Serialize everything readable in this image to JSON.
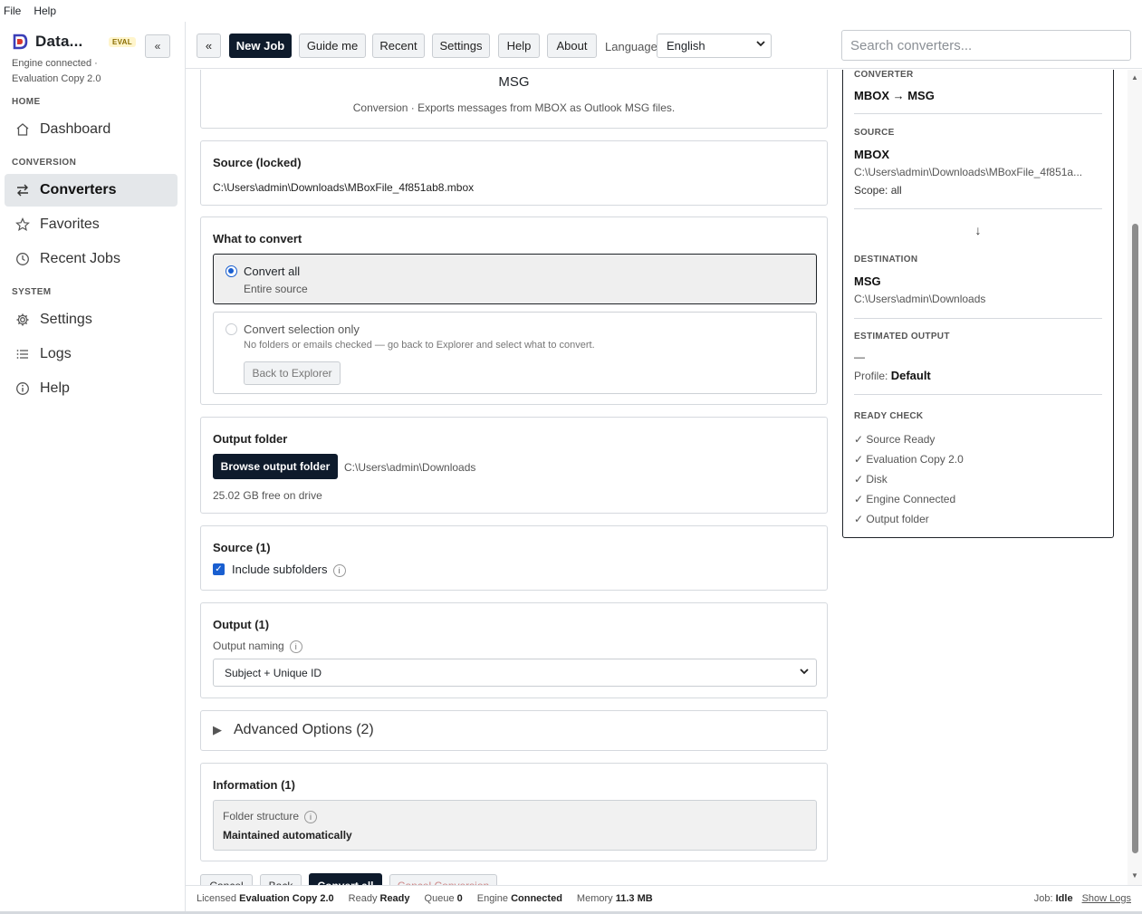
{
  "menu": {
    "file": "File",
    "help": "Help"
  },
  "brand": {
    "name": "Data...",
    "badge": "EVAL",
    "collapse": "«",
    "status_line1": "Engine connected ·",
    "status_line2": "Evaluation Copy 2.0"
  },
  "sidebar": {
    "sections": {
      "home": "HOME",
      "conversion": "CONVERSION",
      "system": "SYSTEM"
    },
    "items": [
      {
        "label": "Dashboard",
        "icon": "home-icon"
      },
      {
        "label": "Converters",
        "icon": "arrows-swap-icon",
        "active": true
      },
      {
        "label": "Favorites",
        "icon": "star-icon"
      },
      {
        "label": "Recent Jobs",
        "icon": "clock-icon"
      },
      {
        "label": "Settings",
        "icon": "gear-icon"
      },
      {
        "label": "Logs",
        "icon": "list-icon"
      },
      {
        "label": "Help",
        "icon": "info-icon"
      }
    ]
  },
  "toolbar": {
    "back": "«",
    "new_job": "New Job",
    "guide": "Guide me",
    "recent": "Recent",
    "settings": "Settings",
    "help": "Help",
    "about": "About",
    "language_label": "Language",
    "language_value": "English",
    "search_placeholder": "Search converters..."
  },
  "header_card": {
    "title": "MSG",
    "subtitle": "Conversion · Exports messages from MBOX as Outlook MSG files."
  },
  "source_locked": {
    "title": "Source (locked)",
    "path": "C:\\Users\\admin\\Downloads\\MBoxFile_4f851ab8.mbox"
  },
  "what_to_convert": {
    "title": "What to convert",
    "all_label": "Convert all",
    "all_sub": "Entire source",
    "sel_label": "Convert selection only",
    "sel_sub": "No folders or emails checked — go back to Explorer and select what to convert.",
    "back_btn": "Back to Explorer"
  },
  "output_folder": {
    "title": "Output folder",
    "browse": "Browse output folder",
    "path": "C:\\Users\\admin\\Downloads",
    "free": "25.02 GB free on drive"
  },
  "source_opts": {
    "title": "Source (1)",
    "include_subfolders": "Include subfolders",
    "info": "i"
  },
  "output_opts": {
    "title": "Output (1)",
    "naming_label": "Output naming",
    "info": "i",
    "naming_value": "Subject + Unique ID"
  },
  "advanced": {
    "title": "Advanced Options (2)",
    "arrow": "▶"
  },
  "information": {
    "title": "Information (1)",
    "label": "Folder structure",
    "info": "i",
    "value": "Maintained automatically"
  },
  "actions": {
    "cancel": "Cancel",
    "back": "Back",
    "convert": "Convert all",
    "cancel_conv": "Cancel Conversion"
  },
  "summary": {
    "converter_label": "CONVERTER",
    "converter_value": "MBOX → MSG",
    "source_label": "SOURCE",
    "source_value": "MBOX",
    "source_path": "C:\\Users\\admin\\Downloads\\MBoxFile_4f851a...",
    "scope": "Scope: all",
    "arrow": "↓",
    "dest_label": "DESTINATION",
    "dest_value": "MSG",
    "dest_path": "C:\\Users\\admin\\Downloads",
    "est_label": "ESTIMATED OUTPUT",
    "est_value": "—",
    "profile_label": "Profile:",
    "profile_value": "Default",
    "ready_label": "READY CHECK",
    "checks": [
      "✓ Source Ready",
      "✓ Evaluation Copy 2.0",
      "✓ Disk",
      "✓ Engine Connected",
      "✓ Output folder"
    ]
  },
  "status": {
    "licensed_label": "Licensed",
    "licensed_value": "Evaluation Copy 2.0",
    "ready_label": "Ready",
    "ready_value": "Ready",
    "queue_label": "Queue",
    "queue_value": "0",
    "engine_label": "Engine",
    "engine_value": "Connected",
    "memory_label": "Memory",
    "memory_value": "11.3 MB",
    "job_label": "Job:",
    "job_value": "Idle",
    "show_logs": "Show Logs"
  }
}
